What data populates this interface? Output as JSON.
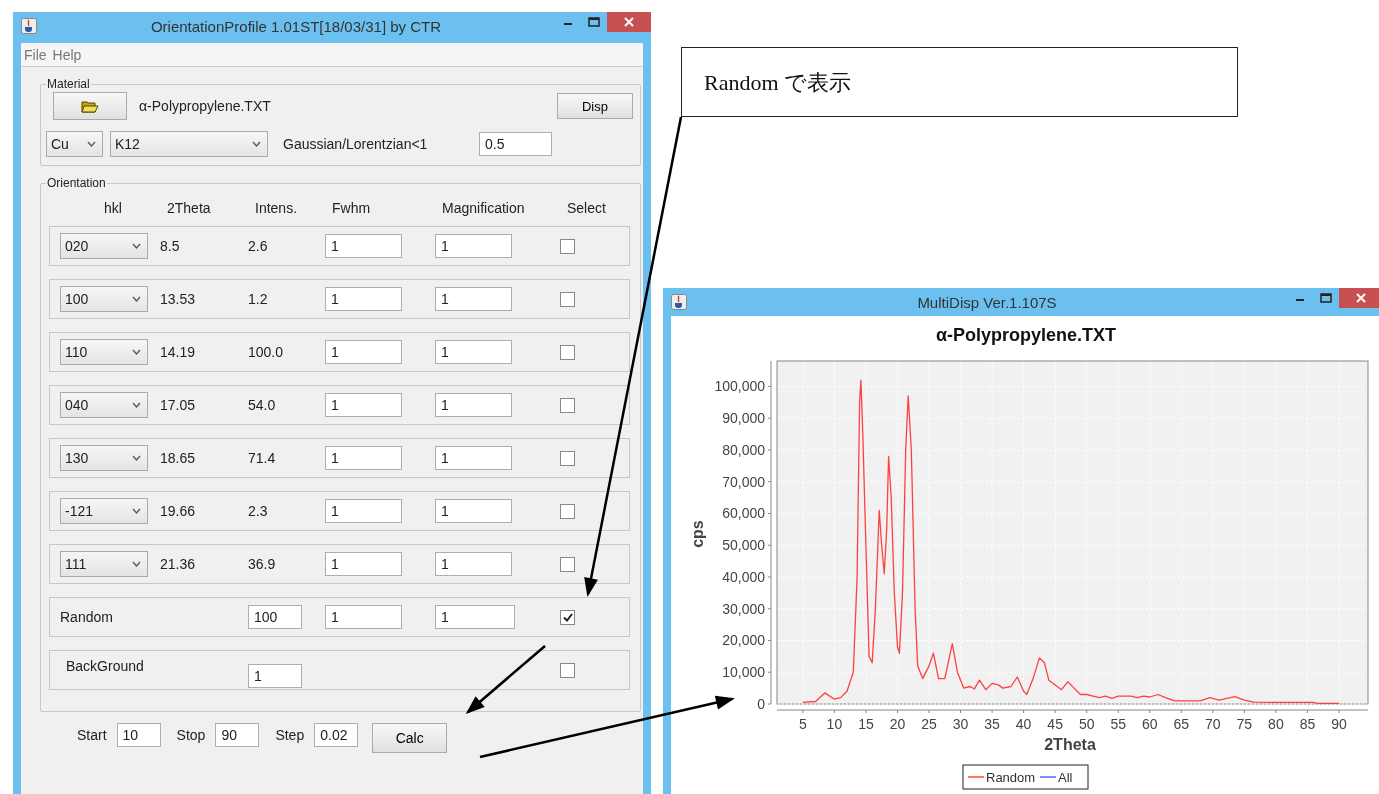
{
  "left_window": {
    "title": "OrientationProfile 1.01ST[18/03/31] by CTR",
    "menu": [
      "File",
      "Help"
    ],
    "material": {
      "legend": "Material",
      "file_name": "α-Polypropylene.TXT",
      "disp_button": "Disp",
      "target": "Cu",
      "line": "K12",
      "ratio_label": "Gaussian/Lorentzian<1",
      "ratio_value": "0.5"
    },
    "orientation": {
      "legend": "Orientation",
      "columns": [
        "hkl",
        "2Theta",
        "Intens.",
        "Fwhm",
        "Magnification",
        "Select"
      ],
      "rows": [
        {
          "kind": "peak",
          "hkl": "020",
          "two_theta": "8.5",
          "intensity": "2.6",
          "fwhm": "1",
          "magnification": "1",
          "checked": false
        },
        {
          "kind": "peak",
          "hkl": "100",
          "two_theta": "13.53",
          "intensity": "1.2",
          "fwhm": "1",
          "magnification": "1",
          "checked": false
        },
        {
          "kind": "peak",
          "hkl": "110",
          "two_theta": "14.19",
          "intensity": "100.0",
          "fwhm": "1",
          "magnification": "1",
          "checked": false
        },
        {
          "kind": "peak",
          "hkl": "040",
          "two_theta": "17.05",
          "intensity": "54.0",
          "fwhm": "1",
          "magnification": "1",
          "checked": false
        },
        {
          "kind": "peak",
          "hkl": "130",
          "two_theta": "18.65",
          "intensity": "71.4",
          "fwhm": "1",
          "magnification": "1",
          "checked": false
        },
        {
          "kind": "peak",
          "hkl": "-121",
          "two_theta": "19.66",
          "intensity": "2.3",
          "fwhm": "1",
          "magnification": "1",
          "checked": false
        },
        {
          "kind": "peak",
          "hkl": "111",
          "two_theta": "21.36",
          "intensity": "36.9",
          "fwhm": "1",
          "magnification": "1",
          "checked": false
        },
        {
          "kind": "random",
          "label": "Random",
          "intensity": "100",
          "fwhm": "1",
          "magnification": "1",
          "checked": true
        },
        {
          "kind": "background",
          "label": "BackGround",
          "intensity": "1",
          "checked": false
        }
      ]
    },
    "range": {
      "start_label": "Start",
      "start": "10",
      "stop_label": "Stop",
      "stop": "90",
      "step_label": "Step",
      "step": "0.02",
      "calc_button": "Calc"
    }
  },
  "callout": {
    "text": "Random で表示"
  },
  "chart_window": {
    "title": "MultiDisp Ver.1.107S",
    "chart_data": {
      "type": "line",
      "title": "α-Polypropylene.TXT",
      "xlabel": "2Theta",
      "ylabel": "cps",
      "x": [
        5,
        7,
        8.5,
        10,
        11,
        12,
        13,
        13.6,
        14,
        14.2,
        14.5,
        15,
        15.5,
        16,
        16.5,
        17,
        17.1,
        17.5,
        17.9,
        18.3,
        18.6,
        19,
        19.5,
        20,
        20.3,
        20.8,
        21.3,
        21.7,
        22.2,
        22.8,
        23.2,
        24,
        25,
        25.7,
        26.5,
        27.5,
        28.7,
        29.5,
        30.5,
        31.5,
        32.2,
        33,
        34,
        35,
        36,
        36.7,
        38,
        39,
        40,
        40.5,
        41.5,
        42.5,
        43.3,
        44,
        45,
        46,
        47,
        48,
        49,
        50,
        51,
        52,
        53,
        54,
        55,
        57,
        58,
        59,
        60,
        61.3,
        62.5,
        64,
        68,
        69.5,
        71,
        73.5,
        75,
        76.5,
        80,
        86,
        86.5,
        90
      ],
      "series": [
        {
          "name": "Random",
          "color": "#ff4040",
          "values": [
            500,
            800,
            3500,
            1500,
            2000,
            4000,
            10000,
            40000,
            95000,
            102000,
            85000,
            50000,
            15000,
            13000,
            30000,
            55000,
            61000,
            50000,
            41000,
            55000,
            78000,
            65000,
            35000,
            18000,
            16000,
            35000,
            80000,
            97000,
            80000,
            30000,
            12000,
            8000,
            12000,
            16000,
            8000,
            8000,
            19000,
            10000,
            5000,
            5500,
            4800,
            7500,
            4500,
            6500,
            6000,
            5000,
            5500,
            8500,
            4000,
            3000,
            8000,
            14500,
            13000,
            7500,
            6000,
            4500,
            7000,
            5000,
            3000,
            3000,
            2500,
            2000,
            2500,
            1800,
            2500,
            2500,
            2000,
            2500,
            2200,
            3000,
            2000,
            1000,
            1000,
            2000,
            1200,
            2300,
            1200,
            600,
            500,
            500,
            200,
            200
          ]
        },
        {
          "name": "All",
          "color": "#6060ff",
          "values": [
            null,
            null,
            null,
            null,
            null,
            null,
            null,
            null,
            null,
            null,
            null,
            null,
            null,
            null,
            null,
            null,
            null,
            null,
            null,
            null,
            null,
            null,
            null,
            null,
            null,
            null,
            null,
            null,
            null,
            null,
            null,
            null,
            null,
            null,
            null,
            null,
            null,
            null,
            null,
            null,
            null,
            null,
            null,
            null,
            null,
            null,
            null,
            null,
            null,
            null,
            null,
            null,
            null,
            null,
            null,
            null,
            null,
            null,
            null,
            null,
            null,
            null,
            null,
            null,
            null,
            null,
            null,
            null,
            null,
            null,
            null,
            null,
            null,
            null,
            null,
            null,
            null,
            null,
            null,
            null,
            null,
            null
          ]
        }
      ],
      "grid": true,
      "legend": "bottom",
      "xlim": [
        0.9,
        94.6
      ],
      "ylim": [
        0,
        108000
      ],
      "xticks": [
        5,
        10,
        15,
        20,
        25,
        30,
        35,
        40,
        45,
        50,
        55,
        60,
        65,
        70,
        75,
        80,
        85,
        90
      ],
      "yticks": [
        {
          "value": 0,
          "label": "0"
        },
        {
          "value": 10000,
          "label": "10,000"
        },
        {
          "value": 20000,
          "label": "20,000"
        },
        {
          "value": 30000,
          "label": "30,000"
        },
        {
          "value": 40000,
          "label": "40,000"
        },
        {
          "value": 50000,
          "label": "50,000"
        },
        {
          "value": 60000,
          "label": "60,000"
        },
        {
          "value": 70000,
          "label": "70,000"
        },
        {
          "value": 80000,
          "label": "80,000"
        },
        {
          "value": 90000,
          "label": "90,000"
        },
        {
          "value": 100000,
          "label": "100,000"
        }
      ]
    }
  }
}
